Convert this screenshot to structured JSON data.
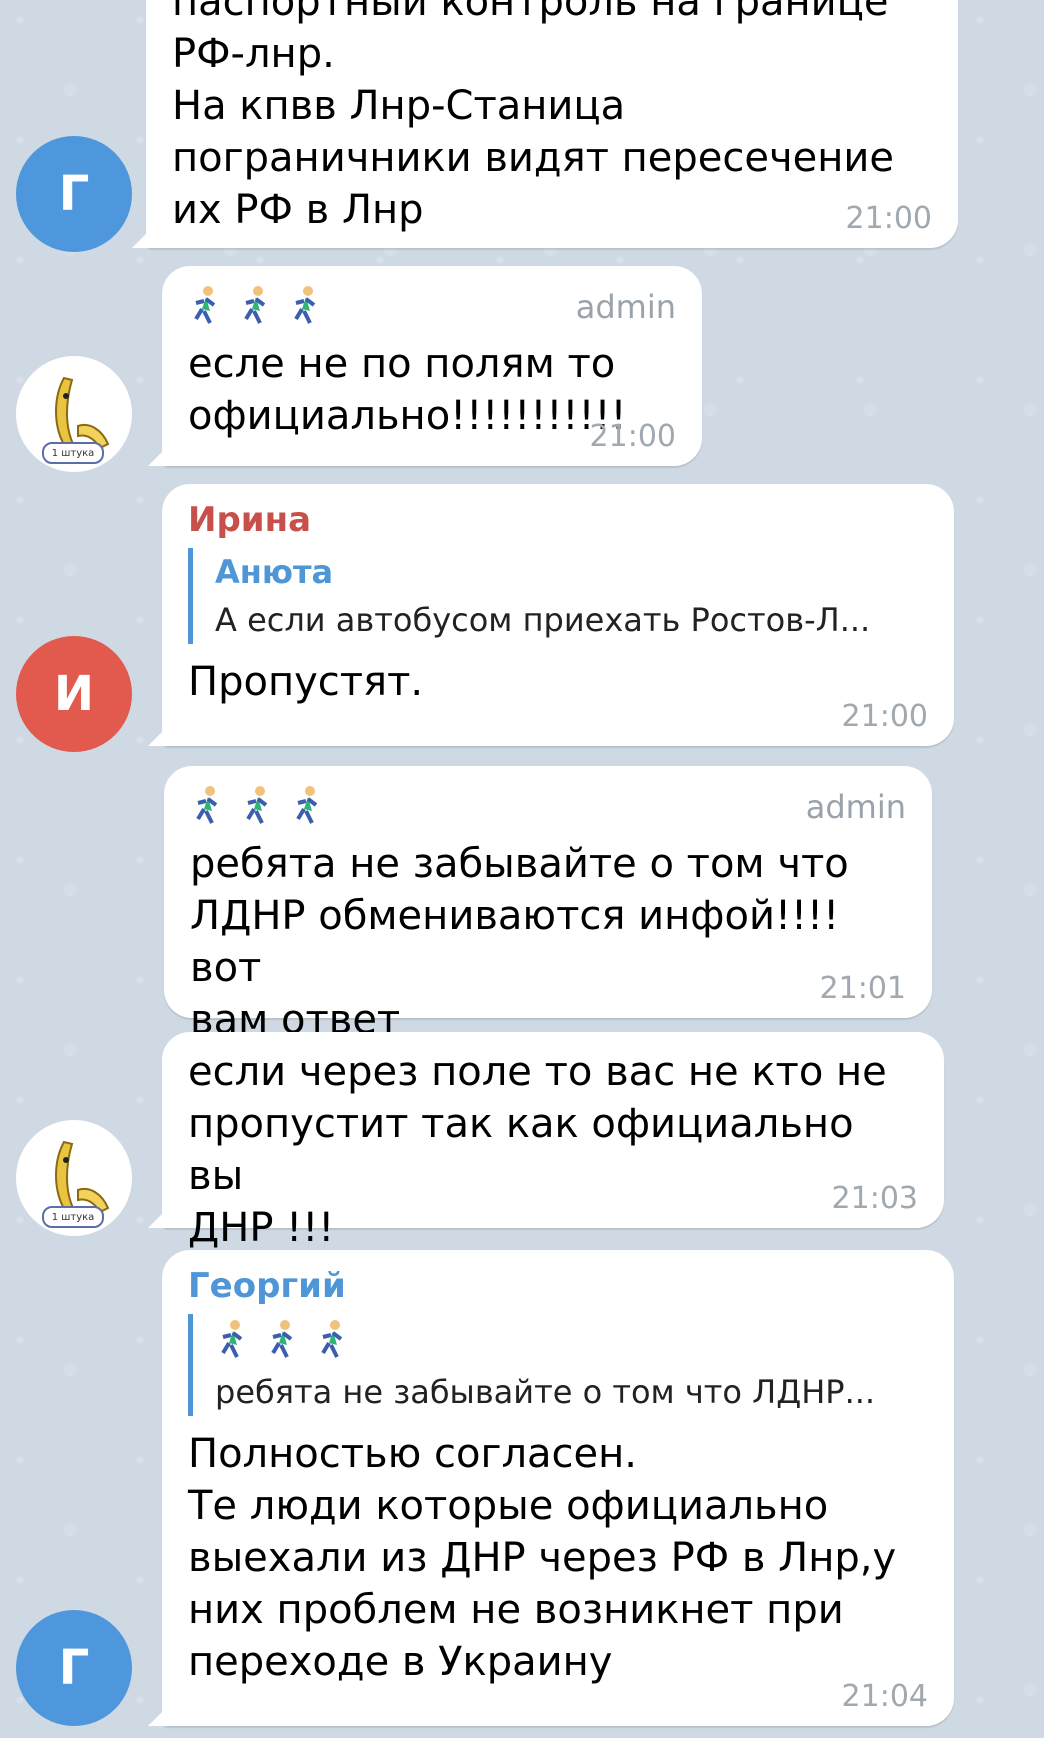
{
  "messages": [
    {
      "text": "паспортный контроль на границе\nРФ-лнр.\nНа кпвв Лнр-Станица\nпограничники видят пересечение\nих РФ в Лнр",
      "time": "21:00",
      "avatar": "Г",
      "avatar_color": "#4f97dc"
    },
    {
      "tag": "admin",
      "text": "есле не по полям то\nофициально!!!!!!!!!!!",
      "time": "21:00",
      "avatar_badge": "1 штука"
    },
    {
      "sender": "Ирина",
      "sender_color": "#c8504a",
      "quote_name": "Анюта",
      "quote_text": "А если автобусом приехать Ростов-Л...",
      "text": "Пропустят.",
      "time": "21:00",
      "avatar": "И",
      "avatar_color": "#e2594e"
    },
    {
      "tag": "admin",
      "text": "ребята не забывайте о том что\nЛДНР обмениваются инфой!!!! вот\nвам ответ",
      "time": "21:01"
    },
    {
      "text": "если через поле то вас не кто не\nпропустит так как официально вы\nДНР !!!",
      "time": "21:03",
      "avatar_badge": "1 штука"
    },
    {
      "sender": "Георгий",
      "sender_color": "#4f96d6",
      "quote_text": "ребята не забывайте о том что ЛДНР...",
      "text": "Полностью согласен.\nТе люди которые официально\nвыехали из ДНР через РФ в Лнр,у\nних проблем не возникнет при\nпереходе в Украину",
      "time": "21:04",
      "avatar": "Г",
      "avatar_color": "#4f97dc"
    }
  ]
}
